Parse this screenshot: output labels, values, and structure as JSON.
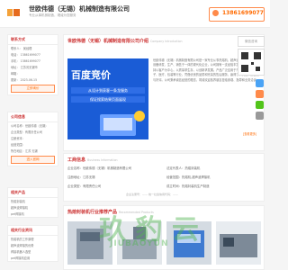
{
  "header": {
    "title": "世欧伟德（无锡）机械制造有限公司",
    "subtitle": "专业从事机械制造，竭诚为您服务",
    "phone": "13861699077"
  },
  "side": {
    "contact_title": "联系方式",
    "contact_rows": [
      "联系人：  吴经理",
      "电话：  13861699077",
      "手机：  13861699077",
      "地址：  江苏省无锡市",
      "邮箱：",
      "更新：  2023-06-15"
    ],
    "contact_btn": "立即询价",
    "company_title": "公司信息",
    "company_rows": [
      "公司名称：世欧伟德（无锡）",
      "企业类型：有限责任公司",
      "注册资本：",
      "经营范围：",
      "所在地区：江苏 无锡"
    ],
    "company_btn": "进入官网",
    "products_title": "相关产品",
    "products_rows": [
      "热熔封装机",
      "超声波焊接机",
      "pet焊接机"
    ],
    "industry_title": "相关行业资讯",
    "industry_rows": [
      "热熔机的工作原理",
      "超声波焊接的优势",
      "焊接机器人选型",
      "pet焊接机应用"
    ]
  },
  "main": {
    "intro_title": "世欧伟德（无锡）机械制造有限公司介绍",
    "intro_sub": "Company Introduction",
    "banner_title": "百度竞价",
    "banner_lines": [
      "从设计到获客一条龙服务",
      "保证搜索结果页面展现"
    ],
    "intro_text": "世欧伟德（无锡）机械制造有限公司是一家专业从事热熔机、超声波焊接机及自动化设备研发、生产、销售于一体的现代化企业，公司拥有一支经验丰富的技术团队，坚持以客户为中心，以质量求生存，以创新求发展。产品广泛应用于汽车、家电、电子、医疗、包装等行业，凭借优良的品质和完善的售后服务，赢得了广大客户的信赖与好评。公司秉承诚信经营的理念，竭诚欢迎各界朋友莅临参观、指导和业务洽谈。",
    "more_link": "[查看更多]",
    "business_title": "工商信息",
    "business_sub": "Business Information",
    "business": [
      [
        "企业名称：",
        "世欧伟德（无锡）机械制造有限公司"
      ],
      [
        "法定代表人：",
        "热熔封装机"
      ],
      [
        "注册地址：",
        "江苏无锡"
      ],
      [
        "经营范围：",
        "热熔机,超声波焊接机"
      ],
      [
        "企业类型：",
        "有限责任公司"
      ],
      [
        "成立时间：",
        "热熔封装机生产制造"
      ]
    ],
    "reg_line": "企业注册号：——  统一社会信用代码：——",
    "products_title": "热熔封装机行业推荐产品",
    "products_sub": "Recommended Products"
  },
  "floating": {
    "wechat": "微信咨询",
    "watermark": "玖 豹 云",
    "watermark_sub": "JIUBAOYUN"
  }
}
